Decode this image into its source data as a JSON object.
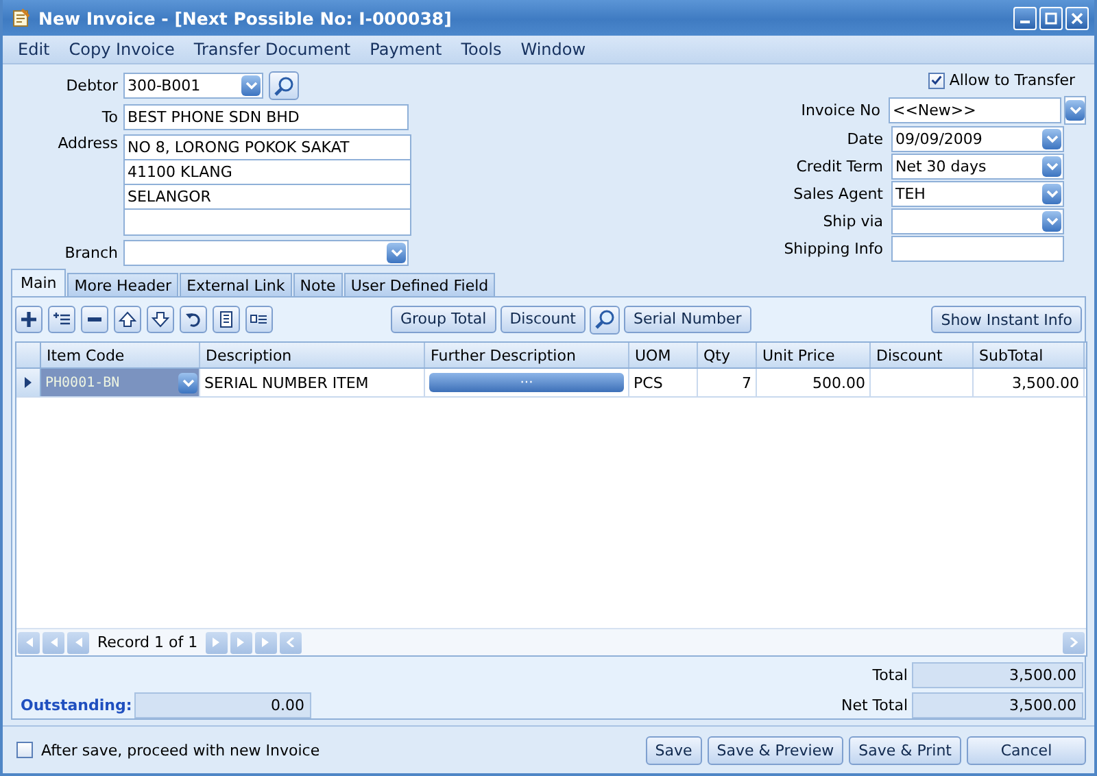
{
  "window": {
    "title": "New Invoice - [Next Possible No: I-000038]"
  },
  "menu": [
    "Edit",
    "Copy Invoice",
    "Transfer Document",
    "Payment",
    "Tools",
    "Window"
  ],
  "debtor": {
    "label": "Debtor",
    "value": "300-B001"
  },
  "to": {
    "label": "To",
    "value": "BEST PHONE SDN BHD"
  },
  "address": {
    "label": "Address",
    "lines": [
      "NO 8, LORONG POKOK SAKAT",
      "41100 KLANG",
      "SELANGOR"
    ]
  },
  "branch": {
    "label": "Branch"
  },
  "allow_to_transfer": {
    "label": "Allow to Transfer",
    "checked": true
  },
  "fields": [
    {
      "label": "Invoice No",
      "value": "<<New>>",
      "kind": "split-combo"
    },
    {
      "label": "Date",
      "value": "09/09/2009",
      "kind": "combo"
    },
    {
      "label": "Credit Term",
      "value": "Net 30 days",
      "kind": "combo"
    },
    {
      "label": "Sales Agent",
      "value": "TEH",
      "kind": "combo"
    },
    {
      "label": "Ship via",
      "kind": "combo"
    },
    {
      "label": "Shipping Info",
      "kind": "text"
    }
  ],
  "tabs": [
    {
      "label": "Main",
      "selected": true
    },
    {
      "label": "More Header",
      "selected": false
    },
    {
      "label": "External Link",
      "selected": false
    },
    {
      "label": "Note",
      "selected": false
    },
    {
      "label": "User Defined Field",
      "selected": false
    }
  ],
  "toolbar_buttons": [
    {
      "kind": "text",
      "label": "Group Total"
    },
    {
      "kind": "text",
      "label": "Discount"
    },
    {
      "kind": "search"
    },
    {
      "kind": "text",
      "label": "Serial Number"
    }
  ],
  "instant_info_button": "Show Instant Info",
  "table": {
    "columns": [
      "Item Code",
      "Description",
      "Further Description",
      "UOM",
      "Qty",
      "Unit Price",
      "Discount",
      "SubTotal"
    ],
    "rows": [
      {
        "selected": true,
        "cells": [
          "PH0001-BN",
          "SERIAL NUMBER ITEM",
          "···",
          "PCS",
          "7",
          "500.00",
          "",
          "3,500.00"
        ]
      }
    ]
  },
  "navigator": "Record 1 of 1",
  "total": {
    "label": "Total",
    "value": "3,500.00"
  },
  "net_total": {
    "label": "Net Total",
    "value": "3,500.00"
  },
  "outstanding": {
    "label": "Outstanding:",
    "value": "0.00"
  },
  "proceed_new": {
    "label": "After save, proceed with new Invoice",
    "checked": false
  },
  "buttons": [
    "Save",
    "Save & Preview",
    "Save & Print",
    "Cancel"
  ]
}
